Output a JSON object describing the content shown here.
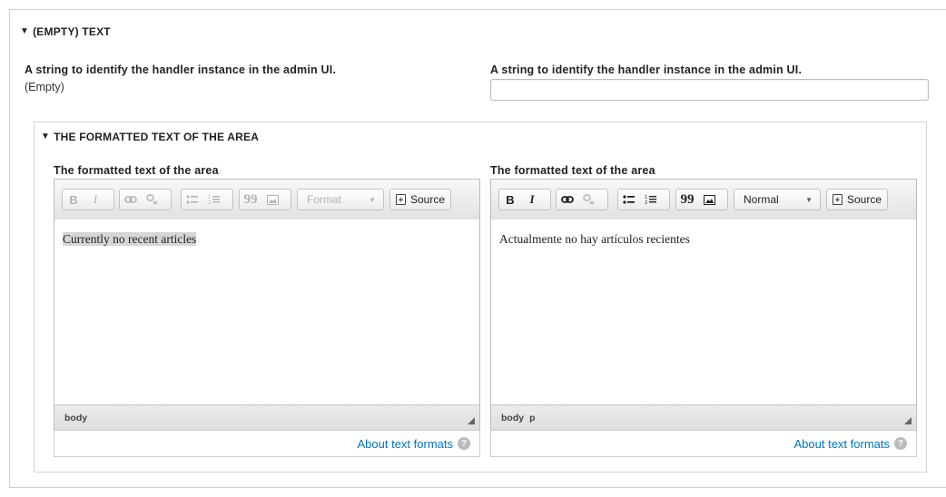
{
  "outer_section": {
    "title": "(EMPTY) TEXT",
    "left_label": "A string to identify the handler instance in the admin UI.",
    "left_value": "(Empty)",
    "right_label": "A string to identify the handler instance in the admin UI.",
    "right_input_value": ""
  },
  "inner_section": {
    "title": "THE FORMATTED TEXT OF THE AREA",
    "editors": [
      {
        "label": "The formatted text of the area",
        "state": "disabled",
        "toolbar": {
          "bold": "B",
          "italic": "I",
          "format_selected": "Format",
          "source_label": "Source"
        },
        "content": "Currently no recent articles",
        "status_path": [
          "body"
        ],
        "about_link": "About text formats"
      },
      {
        "label": "The formatted text of the area",
        "state": "enabled",
        "toolbar": {
          "bold": "B",
          "italic": "I",
          "format_selected": "Normal",
          "source_label": "Source"
        },
        "content": "Actualmente no hay artículos recientes",
        "status_path": [
          "body",
          "p"
        ],
        "about_link": "About text formats"
      }
    ]
  },
  "icons": {
    "collapse": "▼",
    "link": "link-icon",
    "unlink": "unlink-icon",
    "bullet_list": "bulleted-list-icon",
    "numbered_list": "numbered-list-icon",
    "blockquote": "blockquote-icon",
    "image": "image-icon",
    "source": "source-icon",
    "help": "?"
  },
  "colors": {
    "link": "#0074bd",
    "border": "#cfcfcf",
    "selection_highlight": "#d6d6d6"
  }
}
